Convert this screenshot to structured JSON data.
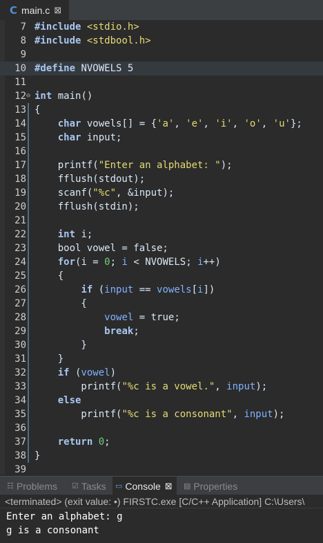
{
  "editor_tab": {
    "icon": "C",
    "filename": "main.c",
    "close": "⊠"
  },
  "code": {
    "l7": {
      "num": "7",
      "pp": "#include",
      "inc": " <stdio.h>"
    },
    "l8": {
      "num": "8",
      "pp": "#include",
      "inc": " <stdbool.h>"
    },
    "l9": {
      "num": "9"
    },
    "l10": {
      "num": "10",
      "pp": "#define",
      "rest": " NVOWELS 5"
    },
    "l11": {
      "num": "11"
    },
    "l12": {
      "num": "12",
      "kw": "int",
      "rest": " main()"
    },
    "l13": {
      "num": "13",
      "text": "{"
    },
    "l14": {
      "num": "14",
      "indent": "    ",
      "kw": "char",
      "a": " vowels[] = {",
      "s1": "'a'",
      "c1": ", ",
      "s2": "'e'",
      "c2": ", ",
      "s3": "'i'",
      "c3": ", ",
      "s4": "'o'",
      "c4": ", ",
      "s5": "'u'",
      "end": "};"
    },
    "l15": {
      "num": "15",
      "indent": "    ",
      "kw": "char",
      "rest": " input;"
    },
    "l16": {
      "num": "16"
    },
    "l17": {
      "num": "17",
      "a": "    printf(",
      "s": "\"Enter an alphabet: \"",
      "end": ");"
    },
    "l18": {
      "num": "18",
      "text": "    fflush(stdout);"
    },
    "l19": {
      "num": "19",
      "a": "    scanf(",
      "s": "\"%c\"",
      "end": ", &input);"
    },
    "l20": {
      "num": "20",
      "text": "    fflush(stdin);"
    },
    "l21": {
      "num": "21"
    },
    "l22": {
      "num": "22",
      "indent": "    ",
      "kw": "int",
      "rest": " i;"
    },
    "l23": {
      "num": "23",
      "text": "    bool vowel = false;"
    },
    "l24": {
      "num": "24",
      "indent": "    ",
      "kw": "for",
      "a": "(i = ",
      "n": "0",
      "b": "; ",
      "v": "i",
      "c": " < NVOWELS; ",
      "v2": "i",
      "end": "++)"
    },
    "l25": {
      "num": "25",
      "text": "    {"
    },
    "l26": {
      "num": "26",
      "indent": "        ",
      "kw": "if",
      "a": " (",
      "v": "input",
      "b": " == ",
      "v2": "vowels",
      "c": "[",
      "v3": "i",
      "end": "])"
    },
    "l27": {
      "num": "27",
      "text": "        {"
    },
    "l28": {
      "num": "28",
      "indent": "            ",
      "v": "vowel",
      "end": " = true;"
    },
    "l29": {
      "num": "29",
      "indent": "            ",
      "kw": "break",
      "end": ";"
    },
    "l30": {
      "num": "30",
      "text": "        }"
    },
    "l31": {
      "num": "31",
      "text": "    }"
    },
    "l32": {
      "num": "32",
      "indent": "    ",
      "kw": "if",
      "a": " (",
      "v": "vowel",
      "end": ")"
    },
    "l33": {
      "num": "33",
      "a": "        printf(",
      "s": "\"%c is a vowel.\"",
      "b": ", ",
      "v": "input",
      "end": ");"
    },
    "l34": {
      "num": "34",
      "indent": "    ",
      "kw": "else"
    },
    "l35": {
      "num": "35",
      "a": "        printf(",
      "s": "\"%c is a consonant\"",
      "b": ", ",
      "v": "input",
      "end": ");"
    },
    "l36": {
      "num": "36"
    },
    "l37": {
      "num": "37",
      "indent": "    ",
      "kw": "return",
      "a": " ",
      "n": "0",
      "end": ";"
    },
    "l38": {
      "num": "38",
      "text": "}"
    },
    "l39": {
      "num": "39"
    }
  },
  "panel": {
    "problems": "Problems",
    "tasks": "Tasks",
    "console": "Console",
    "console_close": "⊠",
    "properties": "Properties"
  },
  "console_status": "<terminated> (exit value: •) FIRSTC.exe [C/C++ Application] C:\\Users\\",
  "console_output": [
    "Enter an alphabet: g",
    "g is a consonant"
  ]
}
